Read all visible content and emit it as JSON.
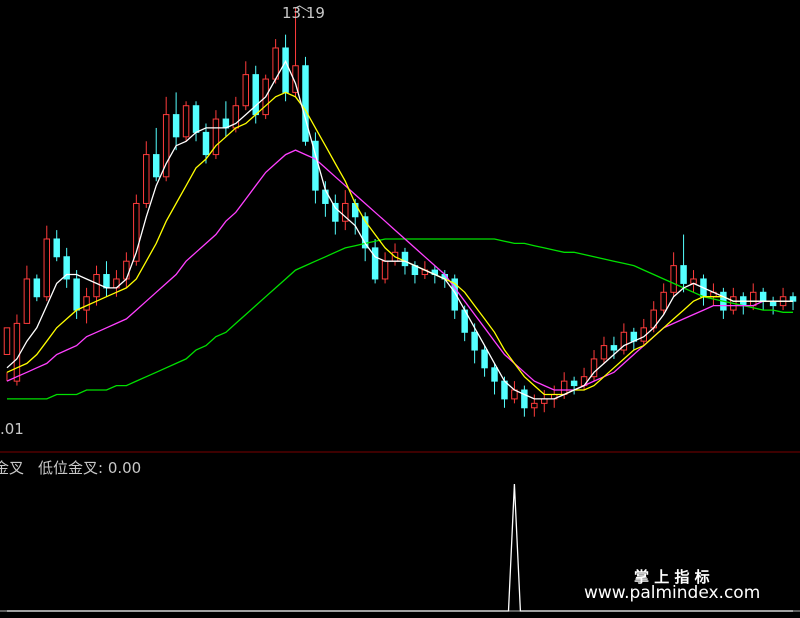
{
  "chart_data": [
    {
      "type": "candlestick",
      "title": "",
      "high_label": "13.19",
      "low_label": ".01",
      "ylim": [
        4.5,
        14.0
      ],
      "grid": false,
      "colors": {
        "up": "#ff3c3c",
        "down": "#54ffff",
        "ma5": "#ffffff",
        "ma10": "#ffff00",
        "ma20": "#ff40ff",
        "ma60": "#00e000"
      },
      "ohlc": [
        [
          6.2,
          6.8,
          5.8,
          5.6
        ],
        [
          5.6,
          6.9,
          5.5,
          7.1
        ],
        [
          6.9,
          7.9,
          6.9,
          8.2
        ],
        [
          7.9,
          7.5,
          7.4,
          8.0
        ],
        [
          7.5,
          8.8,
          7.4,
          9.1
        ],
        [
          8.8,
          8.4,
          8.3,
          9.0
        ],
        [
          8.4,
          7.9,
          7.7,
          8.6
        ],
        [
          7.9,
          7.2,
          7.0,
          8.1
        ],
        [
          7.2,
          7.5,
          6.9,
          7.7
        ],
        [
          7.5,
          8.0,
          7.3,
          8.2
        ],
        [
          8.0,
          7.7,
          7.5,
          8.3
        ],
        [
          7.7,
          7.9,
          7.5,
          8.1
        ],
        [
          7.9,
          8.3,
          7.7,
          8.5
        ],
        [
          8.3,
          9.6,
          8.2,
          9.8
        ],
        [
          9.6,
          10.7,
          9.5,
          11.0
        ],
        [
          10.7,
          10.2,
          10.1,
          11.3
        ],
        [
          10.2,
          11.6,
          10.1,
          12.0
        ],
        [
          11.6,
          11.1,
          10.8,
          12.1
        ],
        [
          11.1,
          11.8,
          11.0,
          11.9
        ],
        [
          11.8,
          11.2,
          11.0,
          11.9
        ],
        [
          11.2,
          10.7,
          10.5,
          11.4
        ],
        [
          10.7,
          11.5,
          10.6,
          11.7
        ],
        [
          11.5,
          11.3,
          11.1,
          11.9
        ],
        [
          11.3,
          11.8,
          11.2,
          12.0
        ],
        [
          11.8,
          12.5,
          11.7,
          12.8
        ],
        [
          12.5,
          11.6,
          11.4,
          12.7
        ],
        [
          11.6,
          12.4,
          11.5,
          12.5
        ],
        [
          12.4,
          13.1,
          12.3,
          13.3
        ],
        [
          13.1,
          12.1,
          11.9,
          13.4
        ],
        [
          12.1,
          12.7,
          12.0,
          14.0
        ],
        [
          12.7,
          11.0,
          10.9,
          12.9
        ],
        [
          11.0,
          9.9,
          9.6,
          11.2
        ],
        [
          9.9,
          9.6,
          9.3,
          10.1
        ],
        [
          9.6,
          9.2,
          8.9,
          9.8
        ],
        [
          9.2,
          9.6,
          9.0,
          9.9
        ],
        [
          9.6,
          9.3,
          8.9,
          9.7
        ],
        [
          9.3,
          8.6,
          8.3,
          9.4
        ],
        [
          8.6,
          7.9,
          7.8,
          8.8
        ],
        [
          7.9,
          8.3,
          7.8,
          8.5
        ],
        [
          8.3,
          8.5,
          8.2,
          8.7
        ],
        [
          8.5,
          8.2,
          8.0,
          8.6
        ],
        [
          8.2,
          8.0,
          7.8,
          8.3
        ],
        [
          8.0,
          8.1,
          7.9,
          8.3
        ],
        [
          8.1,
          8.0,
          7.8,
          8.2
        ],
        [
          8.0,
          7.9,
          7.7,
          8.1
        ],
        [
          7.9,
          7.2,
          7.0,
          8.0
        ],
        [
          7.2,
          6.7,
          6.5,
          7.3
        ],
        [
          6.7,
          6.3,
          6.0,
          6.9
        ],
        [
          6.3,
          5.9,
          5.7,
          6.4
        ],
        [
          5.9,
          5.6,
          5.3,
          6.0
        ],
        [
          5.6,
          5.2,
          5.0,
          5.7
        ],
        [
          5.2,
          5.4,
          5.1,
          5.6
        ],
        [
          5.4,
          5.0,
          4.8,
          5.5
        ],
        [
          5.0,
          5.1,
          4.8,
          5.3
        ],
        [
          5.1,
          5.2,
          4.9,
          5.4
        ],
        [
          5.2,
          5.3,
          5.0,
          5.5
        ],
        [
          5.3,
          5.6,
          5.2,
          5.8
        ],
        [
          5.6,
          5.5,
          5.3,
          5.7
        ],
        [
          5.5,
          5.7,
          5.4,
          5.9
        ],
        [
          5.7,
          6.1,
          5.6,
          6.3
        ],
        [
          6.1,
          6.4,
          6.0,
          6.6
        ],
        [
          6.4,
          6.3,
          6.1,
          6.6
        ],
        [
          6.3,
          6.7,
          6.2,
          6.9
        ],
        [
          6.7,
          6.5,
          6.3,
          6.8
        ],
        [
          6.5,
          6.8,
          6.4,
          7.0
        ],
        [
          6.8,
          7.2,
          6.7,
          7.4
        ],
        [
          7.2,
          7.6,
          7.1,
          7.8
        ],
        [
          7.6,
          8.2,
          7.5,
          8.5
        ],
        [
          8.2,
          7.8,
          7.6,
          8.9
        ],
        [
          7.8,
          7.9,
          7.6,
          8.1
        ],
        [
          7.9,
          7.5,
          7.3,
          8.0
        ],
        [
          7.5,
          7.6,
          7.3,
          7.8
        ],
        [
          7.6,
          7.2,
          7.0,
          7.7
        ],
        [
          7.2,
          7.5,
          7.1,
          7.7
        ],
        [
          7.5,
          7.3,
          7.1,
          7.6
        ],
        [
          7.3,
          7.6,
          7.2,
          7.8
        ],
        [
          7.6,
          7.4,
          7.2,
          7.7
        ],
        [
          7.4,
          7.3,
          7.1,
          7.5
        ],
        [
          7.3,
          7.5,
          7.2,
          7.7
        ],
        [
          7.5,
          7.4,
          7.2,
          7.6
        ]
      ],
      "ma5": [
        5.9,
        6.1,
        6.5,
        6.8,
        7.3,
        7.8,
        8.0,
        8.0,
        7.9,
        7.8,
        7.7,
        7.7,
        7.9,
        8.5,
        9.3,
        10.0,
        10.5,
        10.9,
        11.0,
        11.2,
        11.3,
        11.3,
        11.3,
        11.4,
        11.6,
        11.8,
        12.0,
        12.4,
        12.8,
        12.3,
        11.5,
        10.7,
        9.9,
        9.5,
        9.3,
        9.1,
        8.7,
        8.4,
        8.3,
        8.3,
        8.3,
        8.2,
        8.1,
        8.0,
        7.9,
        7.6,
        7.2,
        6.8,
        6.4,
        6.0,
        5.6,
        5.4,
        5.3,
        5.2,
        5.2,
        5.2,
        5.3,
        5.4,
        5.5,
        5.8,
        6.0,
        6.2,
        6.4,
        6.5,
        6.6,
        6.8,
        7.1,
        7.5,
        7.7,
        7.8,
        7.7,
        7.6,
        7.5,
        7.4,
        7.4,
        7.4,
        7.4,
        7.4,
        7.4,
        7.4
      ],
      "ma10": [
        5.8,
        5.9,
        6.0,
        6.2,
        6.5,
        6.8,
        7.0,
        7.2,
        7.3,
        7.4,
        7.5,
        7.6,
        7.7,
        7.9,
        8.3,
        8.7,
        9.2,
        9.6,
        10.0,
        10.4,
        10.6,
        10.9,
        11.1,
        11.3,
        11.4,
        11.6,
        11.8,
        12.0,
        12.1,
        12.0,
        11.7,
        11.3,
        10.9,
        10.5,
        10.1,
        9.6,
        9.2,
        8.9,
        8.6,
        8.4,
        8.3,
        8.2,
        8.1,
        8.0,
        7.9,
        7.8,
        7.6,
        7.3,
        7.0,
        6.7,
        6.3,
        6.0,
        5.7,
        5.5,
        5.3,
        5.3,
        5.3,
        5.4,
        5.4,
        5.5,
        5.7,
        5.9,
        6.1,
        6.3,
        6.4,
        6.6,
        6.8,
        7.0,
        7.2,
        7.4,
        7.5,
        7.5,
        7.5,
        7.4,
        7.4,
        7.4,
        7.4,
        7.4,
        7.4,
        7.4
      ],
      "ma20": [
        5.6,
        5.7,
        5.8,
        5.9,
        6.0,
        6.2,
        6.3,
        6.4,
        6.6,
        6.7,
        6.8,
        6.9,
        7.0,
        7.2,
        7.4,
        7.6,
        7.8,
        8.0,
        8.3,
        8.5,
        8.7,
        8.9,
        9.2,
        9.4,
        9.7,
        10.0,
        10.3,
        10.5,
        10.7,
        10.8,
        10.7,
        10.6,
        10.4,
        10.2,
        10.0,
        9.8,
        9.6,
        9.4,
        9.2,
        9.0,
        8.8,
        8.6,
        8.4,
        8.2,
        8.0,
        7.7,
        7.4,
        7.1,
        6.8,
        6.5,
        6.2,
        6.0,
        5.8,
        5.6,
        5.5,
        5.4,
        5.4,
        5.4,
        5.5,
        5.6,
        5.7,
        5.8,
        6.0,
        6.2,
        6.4,
        6.6,
        6.8,
        6.9,
        7.0,
        7.1,
        7.2,
        7.3,
        7.3,
        7.3,
        7.3,
        7.3,
        7.4,
        7.4,
        7.4,
        7.4
      ],
      "ma60": [
        5.2,
        5.2,
        5.2,
        5.2,
        5.2,
        5.3,
        5.3,
        5.3,
        5.4,
        5.4,
        5.4,
        5.5,
        5.5,
        5.6,
        5.7,
        5.8,
        5.9,
        6.0,
        6.1,
        6.3,
        6.4,
        6.6,
        6.7,
        6.9,
        7.1,
        7.3,
        7.5,
        7.7,
        7.9,
        8.1,
        8.2,
        8.3,
        8.4,
        8.5,
        8.6,
        8.65,
        8.7,
        8.75,
        8.8,
        8.8,
        8.8,
        8.8,
        8.8,
        8.8,
        8.8,
        8.8,
        8.8,
        8.8,
        8.8,
        8.8,
        8.75,
        8.7,
        8.7,
        8.65,
        8.6,
        8.55,
        8.5,
        8.5,
        8.45,
        8.4,
        8.35,
        8.3,
        8.25,
        8.2,
        8.1,
        8.0,
        7.9,
        7.8,
        7.7,
        7.6,
        7.5,
        7.45,
        7.4,
        7.35,
        7.3,
        7.25,
        7.2,
        7.2,
        7.15,
        7.15
      ]
    },
    {
      "type": "line",
      "title": "",
      "legend": [
        "金叉",
        "低位金叉: 0.00"
      ],
      "ylim": [
        0,
        1
      ],
      "color": "#ffffff",
      "x": [
        0,
        1,
        2,
        3,
        4,
        5,
        6,
        7,
        8,
        9,
        10,
        11,
        12,
        13,
        14,
        15,
        16,
        17,
        18,
        19,
        20,
        21,
        22,
        23,
        24,
        25,
        26,
        27,
        28,
        29,
        30,
        31,
        32,
        33,
        34,
        35,
        36,
        37,
        38,
        39,
        40,
        41,
        42,
        43,
        44,
        45,
        46,
        47,
        48,
        49,
        50,
        51,
        52,
        53,
        54,
        55,
        56,
        57,
        58,
        59,
        60,
        61,
        62,
        63,
        64,
        65,
        66,
        67,
        68,
        69,
        70,
        71,
        72,
        73,
        74,
        75,
        76,
        77,
        78,
        79
      ],
      "values": [
        0,
        0,
        0,
        0,
        0,
        0,
        0,
        0,
        0,
        0,
        0,
        0,
        0,
        0,
        0,
        0,
        0,
        0,
        0,
        0,
        0,
        0,
        0,
        0,
        0,
        0,
        0,
        0,
        0,
        0,
        0,
        0,
        0,
        0,
        0,
        0,
        0,
        0,
        0,
        0,
        0,
        0,
        0,
        0,
        0,
        0,
        0,
        0,
        0,
        0,
        0,
        0,
        0,
        0,
        0,
        0,
        0,
        0,
        0,
        0,
        0,
        0,
        0,
        0,
        0,
        0,
        0,
        0,
        0,
        0,
        0,
        0,
        0,
        0,
        0,
        0,
        0,
        0,
        0,
        0
      ]
    }
  ],
  "signal_spike": {
    "index": 51,
    "value": 1
  },
  "watermark": {
    "line1": "掌 上 指 标",
    "line2": "www.palmindex.com"
  }
}
